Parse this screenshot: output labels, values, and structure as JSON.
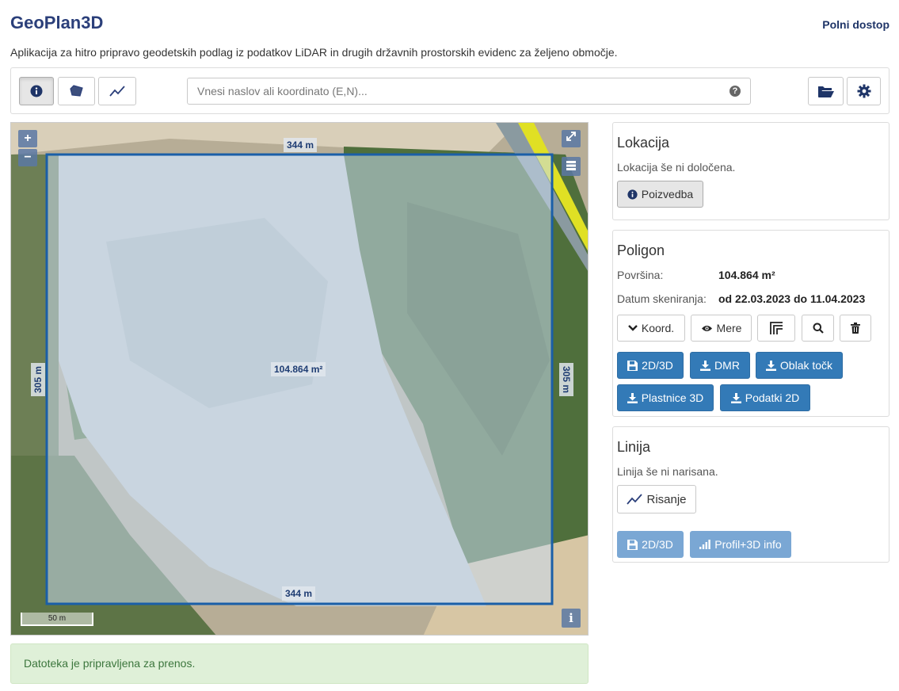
{
  "header": {
    "title": "GeoPlan3D",
    "full_access_link": "Polni dostop",
    "description": "Aplikacija za hitro pripravo geodetskih podlag iz podatkov LiDAR in drugih državnih prostorskih evidenc za željeno območje."
  },
  "toolbar": {
    "mode_buttons": [
      {
        "icon": "info-circle-icon",
        "active": true
      },
      {
        "icon": "polygon-icon",
        "active": false
      },
      {
        "icon": "line-chart-icon",
        "active": false
      }
    ],
    "search": {
      "placeholder": "Vnesi naslov ali koordinato (E,N)...",
      "value": ""
    },
    "open_icon": "folder-open-icon",
    "settings_icon": "gear-icon"
  },
  "map": {
    "zoom_in": "+",
    "zoom_out": "−",
    "polygon": {
      "top_length": "344 m",
      "bottom_length": "344 m",
      "left_length": "305 m",
      "right_length": "305 m",
      "area": "104.864 m²"
    },
    "scale_label": "50 m",
    "info_button": "i",
    "polygon_color": "#1a5fa8"
  },
  "alert": {
    "message": "Datoteka je pripravljena za prenos."
  },
  "location_panel": {
    "title": "Lokacija",
    "status": "Lokacija še ni določena.",
    "query_button": "Poizvedba"
  },
  "polygon_panel": {
    "title": "Poligon",
    "area_label": "Površina:",
    "area_value": "104.864 m²",
    "scan_date_label": "Datum skeniranja:",
    "scan_date_value": "od 22.03.2023 do 11.04.2023",
    "coord_button": "Koord.",
    "measures_button": "Mere",
    "btn_2d3d": "2D/3D",
    "btn_dmr": "DMR",
    "btn_point_cloud": "Oblak točk",
    "btn_contours": "Plastnice 3D",
    "btn_data2d": "Podatki 2D"
  },
  "line_panel": {
    "title": "Linija",
    "status": "Linija še ni narisana.",
    "draw_button": "Risanje",
    "btn_2d3d": "2D/3D",
    "btn_profile": "Profil+3D info"
  },
  "colors": {
    "brand": "#2b3f7a",
    "primary": "#337ab7",
    "primary_disabled": "#7aa7d4",
    "success_bg": "#dff0d8",
    "success_text": "#3c763d"
  }
}
